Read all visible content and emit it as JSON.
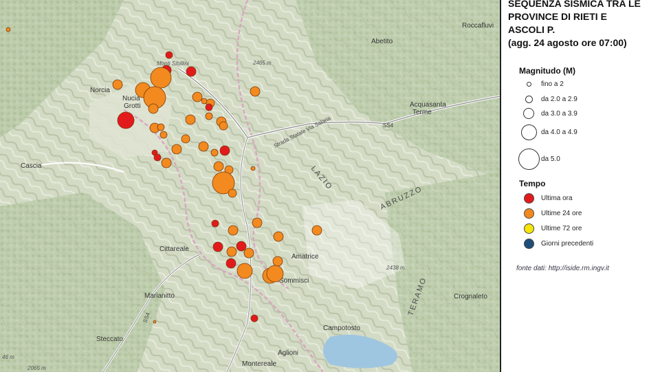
{
  "title_lines": [
    "SEQUENZA SISMICA TRA LE",
    "PROVINCE DI RIETI E",
    "ASCOLI P.",
    "(agg. 24 agosto ore 07:00)"
  ],
  "legend": {
    "magnitude_title": "Magnitudo (M)",
    "magnitudes": [
      "fino a 2",
      "da 2.0 a 2.9",
      "da 3.0 a 3.9",
      "da 4.0 a 4.9",
      "da 5.0"
    ],
    "time_title": "Tempo",
    "times": [
      {
        "label": "Ultima ora",
        "color": "#e31a1c"
      },
      {
        "label": "Ultime 24 ore",
        "color": "#f28a1f"
      },
      {
        "label": "Ultime 72 ore",
        "color": "#f5e50a"
      },
      {
        "label": "Giorni precedenti",
        "color": "#1f4e79"
      }
    ]
  },
  "source": "fonte dati: http://iside.rm.ingv.it",
  "places": {
    "norcia": "Norcia",
    "nucia": "Nucia",
    "grotti": "Grotti",
    "cascia": "Cascia",
    "abetito": "Abetito",
    "roccafluvione": "Roccafluvi",
    "acquasanta": "Acquasanta",
    "terme": "Terme",
    "cittareale": "Cittareale",
    "amatrice": "Amatrice",
    "sommisci": "Sommisci",
    "marianitto": "Marianitto",
    "steccato": "Steccato",
    "campotosto": "Campotosto",
    "aglioni": "Aglioni",
    "montereale": "Montereale",
    "crognaleto": "Crognaleto",
    "monte_sibillini": "Monti Sibillini",
    "lazio": "LAZIO",
    "abruzzo": "ABRUZZO",
    "teramo": "TERAMO",
    "via_salaria": "Strada Statale Via Salaria",
    "ss4_a": "SS4",
    "ss4_b": "SS4",
    "elev_a": "2465 m",
    "elev_b": "2438 m",
    "elev_c": "2065 m",
    "elev_d": "46 m"
  }
}
